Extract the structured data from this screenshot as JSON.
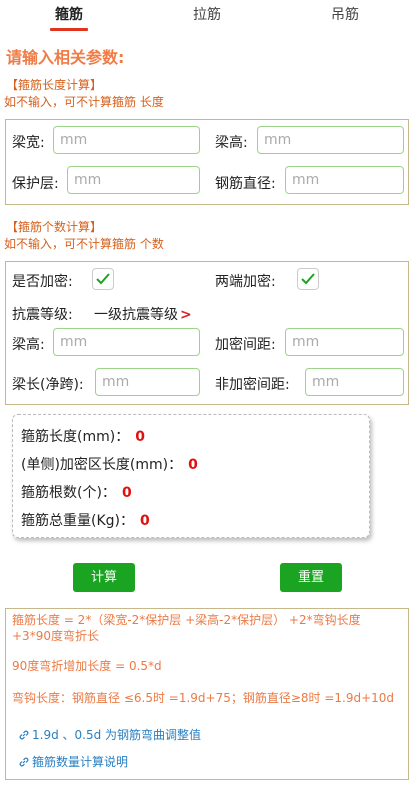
{
  "tabs": [
    "箍筋",
    "拉筋",
    "吊筋"
  ],
  "title": "请输入相关参数:",
  "length_section": {
    "heading": "【箍筋长度计算】",
    "note": "如不输入，可不计算箍筋 长度",
    "beam_width_label": "梁宽:",
    "beam_height_label": "梁高:",
    "cover_label": "保护层:",
    "diameter_label": "钢筋直径:",
    "placeholder": "mm"
  },
  "count_section": {
    "heading": "【箍筋个数计算】",
    "note": "如不输入，可不计算箍筋 个数",
    "densify_label": "是否加密:",
    "both_ends_label": "两端加密:",
    "seismic_label": "抗震等级:",
    "seismic_value": "一级抗震等级",
    "seismic_arrow": ">",
    "beam_height_label": "梁高:",
    "dense_spacing_label": "加密间距:",
    "beam_length_label": "梁长(净跨):",
    "non_dense_spacing_label": "非加密间距:",
    "placeholder": "mm"
  },
  "results": {
    "stirrup_length_label": "箍筋长度(mm)：",
    "stirrup_length_value": "0",
    "dense_zone_label": "(单侧)加密区长度(mm)：",
    "dense_zone_value": "0",
    "count_label": "箍筋根数(个)：",
    "count_value": "0",
    "weight_label": "箍筋总重量(Kg)：",
    "weight_value": "0"
  },
  "buttons": {
    "calculate": "计算",
    "reset": "重置"
  },
  "notes": {
    "formula": "箍筋长度 = 2*（梁宽-2*保护层 +梁高-2*保护层） +2*弯钩长度 +3*90度弯折长",
    "bend90": "90度弯折增加长度 = 0.5*d",
    "hook": "弯钩长度：钢筋直径 ≤6.5时 =1.9d+75；钢筋直径≥8时 =1.9d+10d",
    "link1": "1.9d 、0.5d 为钢筋弯曲调整值",
    "link2": "箍筋数量计算说明"
  },
  "colors": {
    "accent_orange": "#f07b45",
    "button_green": "#1aa421",
    "result_red": "#e01010",
    "link_blue": "#2a7fc1"
  }
}
